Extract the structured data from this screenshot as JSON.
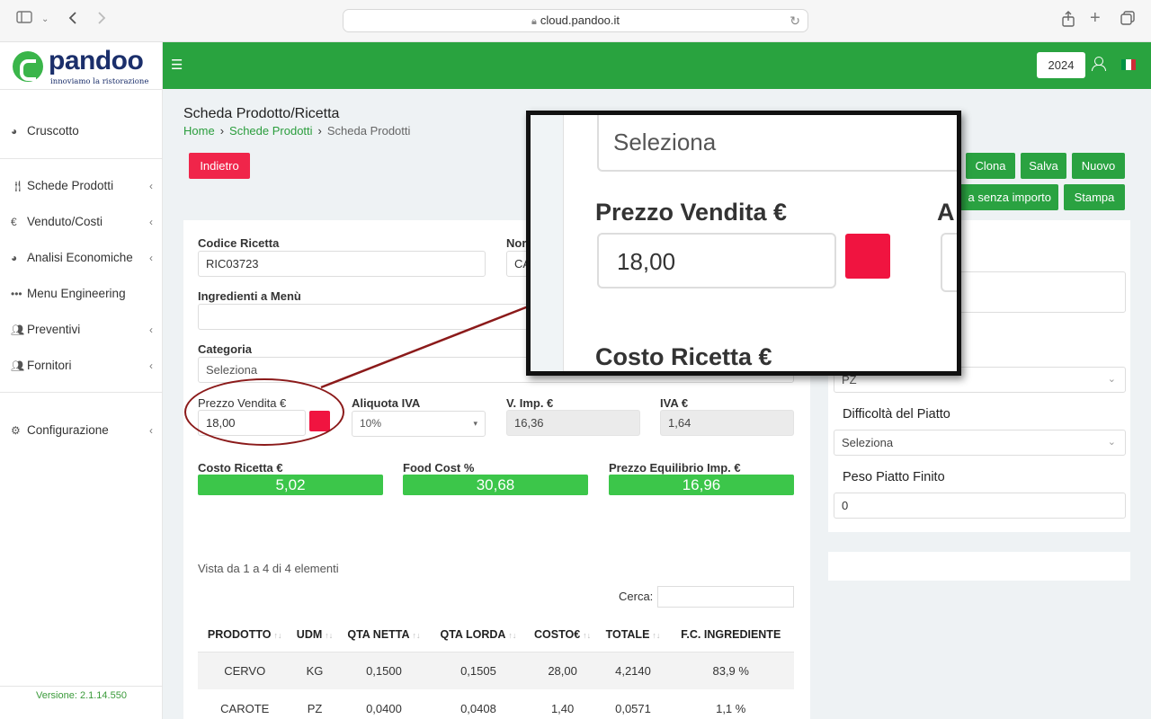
{
  "browser": {
    "url": "cloud.pandoo.it"
  },
  "brand": {
    "name": "pandoo",
    "tagline": "innoviamo la ristorazione"
  },
  "sidebar": {
    "items": [
      {
        "label": "Cruscotto",
        "icon": "pie-chart-icon"
      },
      {
        "label": "Schede Prodotti",
        "icon": "utensils-icon"
      },
      {
        "label": "Venduto/Costi",
        "icon": "euro-icon"
      },
      {
        "label": "Analisi Economiche",
        "icon": "pie-chart-icon"
      },
      {
        "label": "Menu Engineering",
        "icon": "dots-icon"
      },
      {
        "label": "Preventivi",
        "icon": "users-icon"
      },
      {
        "label": "Fornitori",
        "icon": "users-icon"
      },
      {
        "label": "Configurazione",
        "icon": "gear-icon"
      }
    ],
    "version": "Versione: 2.1.14.550"
  },
  "topbar": {
    "year": "2024"
  },
  "page": {
    "title": "Scheda Prodotto/Ricetta",
    "breadcrumb": [
      "Home",
      "Schede Prodotti",
      "Scheda Prodotti"
    ]
  },
  "buttons": {
    "back": "Indietro",
    "clone": "Clona",
    "save": "Salva",
    "new": "Nuovo",
    "print_no_amount": "a senza importo",
    "print": "Stampa"
  },
  "form": {
    "codice_label": "Codice Ricetta",
    "codice_value": "RIC03723",
    "nome_label": "Nor",
    "nome_value": "CA",
    "ingredienti_label": "Ingredienti a Menù",
    "ingredienti_value": "",
    "categoria_label": "Categoria",
    "categoria_value": "Seleziona",
    "prezzo_label": "Prezzo Vendita €",
    "prezzo_value": "18,00",
    "iva_aliquota_label": "Aliquota IVA",
    "iva_aliquota_value": "10%",
    "vimp_label": "V. Imp. €",
    "vimp_value": "16,36",
    "iva_label": "IVA €",
    "iva_value": "1,64",
    "costo_label": "Costo Ricetta €",
    "costo_value": "5,02",
    "foodcost_label": "Food Cost %",
    "foodcost_value": "30,68",
    "equilibrio_label": "Prezzo Equilibrio Imp. €",
    "equilibrio_value": "16,96"
  },
  "right_panel": {
    "udm_value": "PZ",
    "difficolta_label": "Difficoltà del Piatto",
    "difficolta_value": "Seleziona",
    "peso_label": "Peso Piatto Finito",
    "peso_value": "0"
  },
  "table": {
    "info": "Vista da 1 a 4 di 4 elementi",
    "search_label": "Cerca:",
    "headers": [
      "PRODOTTO",
      "UDM",
      "QTA NETTA",
      "QTA LORDA",
      "COSTO€",
      "TOTALE",
      "F.C. INGREDIENTE"
    ],
    "rows": [
      [
        "CERVO",
        "KG",
        "0,1500",
        "0,1505",
        "28,00",
        "4,2140",
        "83,9 %"
      ],
      [
        "CAROTE",
        "PZ",
        "0,0400",
        "0,0408",
        "1,40",
        "0,0571",
        "1,1 %"
      ]
    ]
  },
  "zoom": {
    "select_value": "Seleziona",
    "prezzo_label": "Prezzo Vendita €",
    "prezzo_value": "18,00",
    "next_label_partial": "A",
    "costo_label": "Costo Ricetta €"
  },
  "colors": {
    "brand_green": "#29a33f",
    "kpi_green": "#3cc64a",
    "danger_red": "#f0254a",
    "swatch_red": "#f01440",
    "callout_red": "#8b1a1a"
  }
}
